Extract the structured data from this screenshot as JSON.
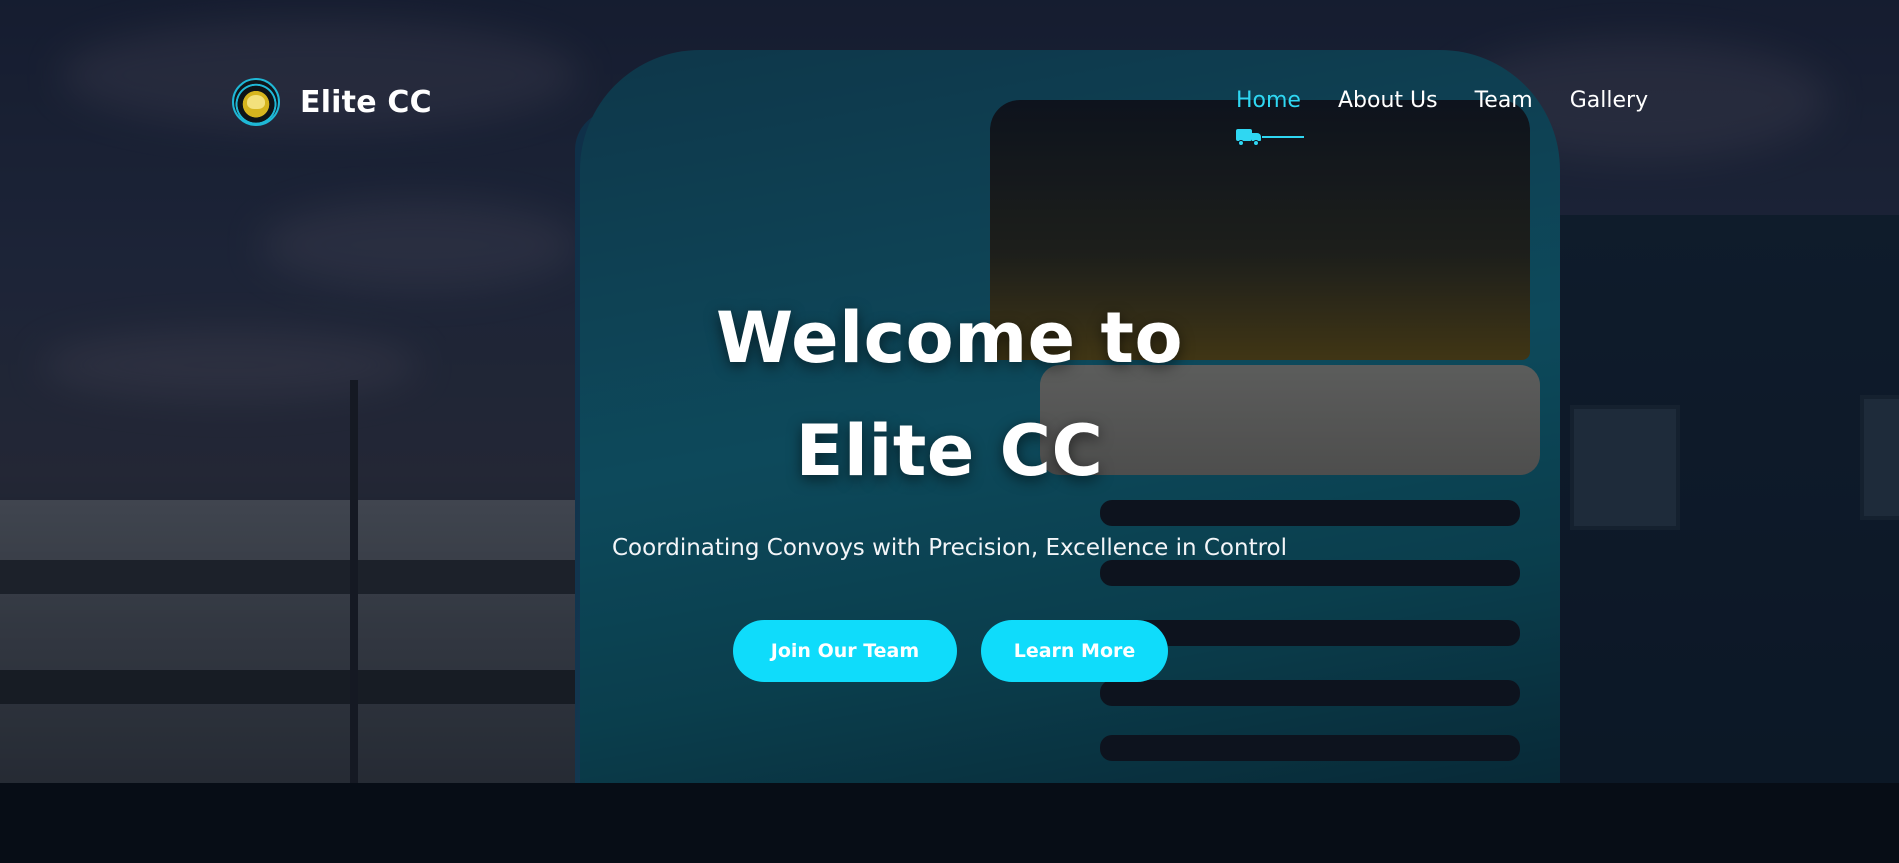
{
  "brand": {
    "name": "Elite CC",
    "logo_icon": "elite-convoys-eagle-logo"
  },
  "nav": {
    "items": [
      {
        "label": "Home",
        "active": true
      },
      {
        "label": "About Us",
        "active": false
      },
      {
        "label": "Team",
        "active": false
      },
      {
        "label": "Gallery",
        "active": false
      }
    ],
    "active_indicator_icon": "truck-icon"
  },
  "hero": {
    "title_line1": "Welcome to",
    "title_line2": "Elite CC",
    "tagline": "Coordinating Convoys with Precision, Excellence in Control",
    "buttons": {
      "join_label": "Join Our Team",
      "learn_label": "Learn More"
    }
  },
  "colors": {
    "accent": "#0fdcfb",
    "nav_active": "#2fd7f2",
    "text": "#ffffff"
  }
}
